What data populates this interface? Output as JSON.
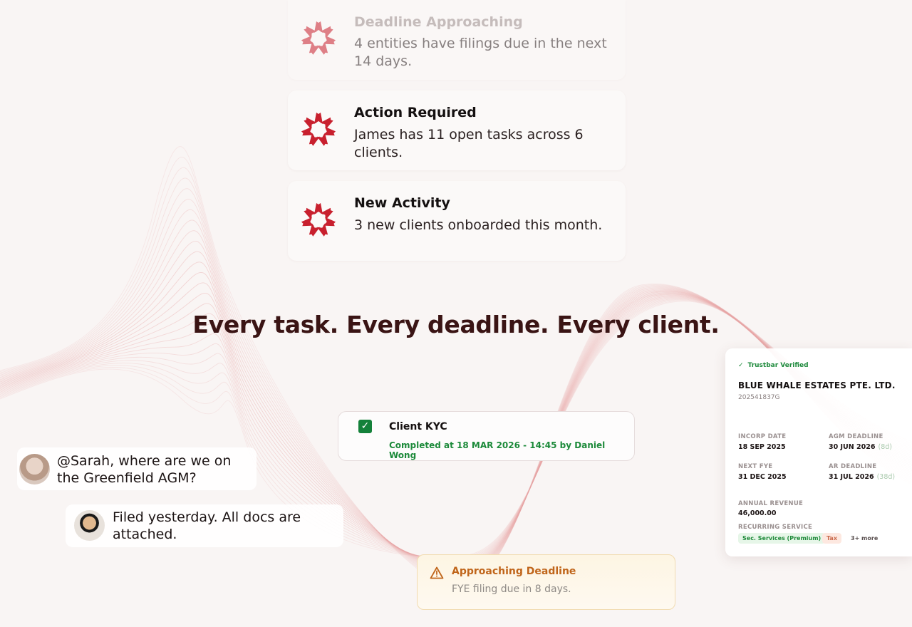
{
  "notifications": [
    {
      "title": "Deadline Approaching",
      "body": "4 entities have filings due in the next 14 days."
    },
    {
      "title": "Action Required",
      "body": "James has 11 open tasks across 6 clients."
    },
    {
      "title": "New Activity",
      "body": "3 new clients onboarded this month."
    }
  ],
  "tagline": "Every task. Every deadline. Every client.",
  "chat": [
    {
      "text": "@Sarah, where are we on the Greenfield AGM?"
    },
    {
      "text": "Filed yesterday. All docs are attached."
    }
  ],
  "kyc": {
    "title": "Client KYC",
    "status": "Completed at 18 MAR 2026 - 14:45 by Daniel Wong"
  },
  "deadline_alert": {
    "title": "Approaching Deadline",
    "body": "FYE filing due in 8 days."
  },
  "entity": {
    "verified": "Trustbar Verified",
    "name": "BLUE WHALE ESTATES PTE. LTD.",
    "uen": "202541837G",
    "incorp_label": "INCORP DATE",
    "incorp_value": "18 SEP 2025",
    "agm_label": "AGM DEADLINE",
    "agm_value": "30 JUN 2026",
    "agm_days": "(8d)",
    "fye_label": "NEXT FYE",
    "fye_value": "31 DEC 2025",
    "ar_label": "AR DEADLINE",
    "ar_value": "31 JUL 2026",
    "ar_days": "(38d)",
    "revenue_label": "ANNUAL REVENUE",
    "revenue_value": "46,000.00",
    "service_label": "RECURRING SERVICE",
    "services": [
      "Sec. Services (Premium)",
      "Tax"
    ],
    "more": "3+ more"
  },
  "colors": {
    "brand_red": "#c8202e",
    "success_green": "#1c8a3a",
    "warning_orange": "#c0651a",
    "heading": "#3a1414"
  },
  "icons": {
    "notification_logo": "brand-burst-icon",
    "kyc": "checkbox-checked-icon",
    "deadline": "warning-triangle-icon",
    "verified": "checkmark-icon"
  }
}
